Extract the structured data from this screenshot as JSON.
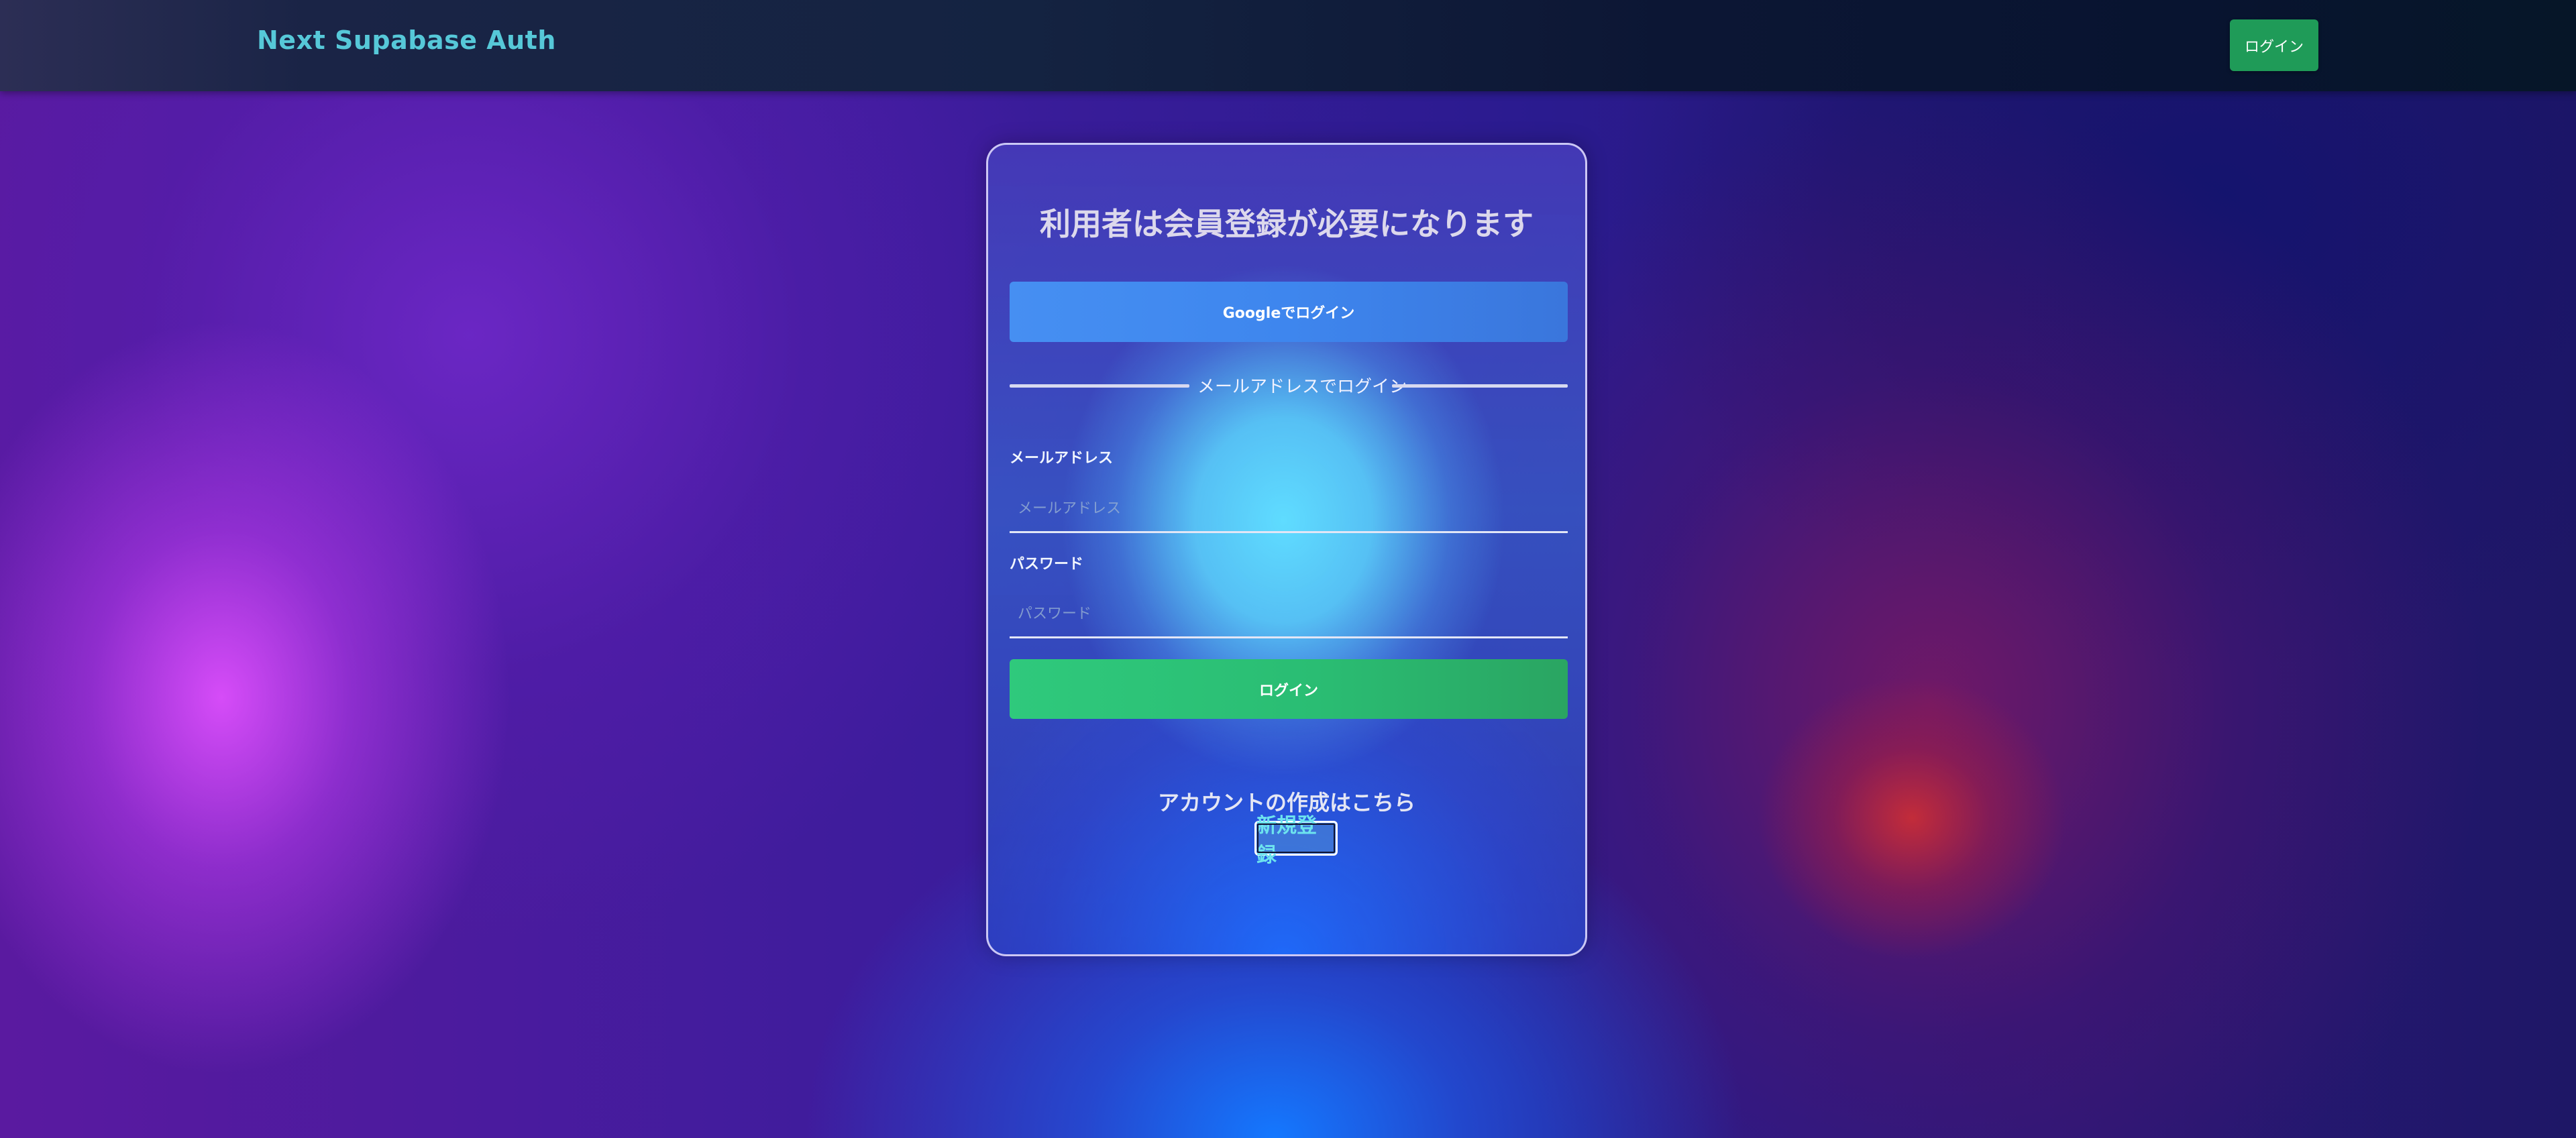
{
  "header": {
    "brand": "Next Supabase Auth",
    "login_label": "ログイン"
  },
  "auth_card": {
    "title": "利用者は会員登録が必要になります",
    "google_login_label": "Googleでログイン",
    "divider_text": "メールアドレスでログイン",
    "email": {
      "label": "メールアドレス",
      "placeholder": "メールアドレス",
      "value": ""
    },
    "password": {
      "label": "パスワード",
      "placeholder": "パスワード",
      "value": ""
    },
    "login_label": "ログイン",
    "signup_prompt": "アカウントの作成はこちら",
    "signup_link": "新規登録"
  },
  "colors": {
    "brand": "#56c8d8",
    "header_login_button": "#1f9b58",
    "google_button": "#4285f4",
    "login_button": "#2fc97c",
    "card_border": "#e6e1ff"
  }
}
